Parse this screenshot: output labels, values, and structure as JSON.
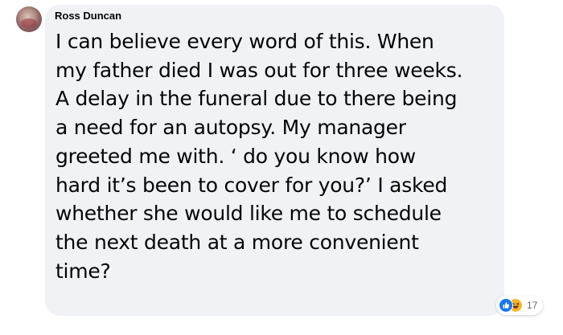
{
  "comment": {
    "author": "Ross Duncan",
    "lines": [
      "I can believe every word of this. When",
      "my father died I was out for three weeks.",
      "A delay in the funeral due to there being",
      "a need for an autopsy. My manager",
      "greeted me with. ‘ do you know how",
      "hard it’s been to cover for you?’ I asked",
      "whether she would like me to schedule",
      "the next death at a more convenient",
      "time?"
    ]
  },
  "reactions": {
    "icons": [
      "like-icon",
      "haha-icon"
    ],
    "count": "17",
    "colors": {
      "like": "#1877f2",
      "haha": "#f7b928"
    }
  },
  "colors": {
    "bubble": "#f0f2f5",
    "text": "#050505",
    "secondary_text": "#65676b"
  }
}
